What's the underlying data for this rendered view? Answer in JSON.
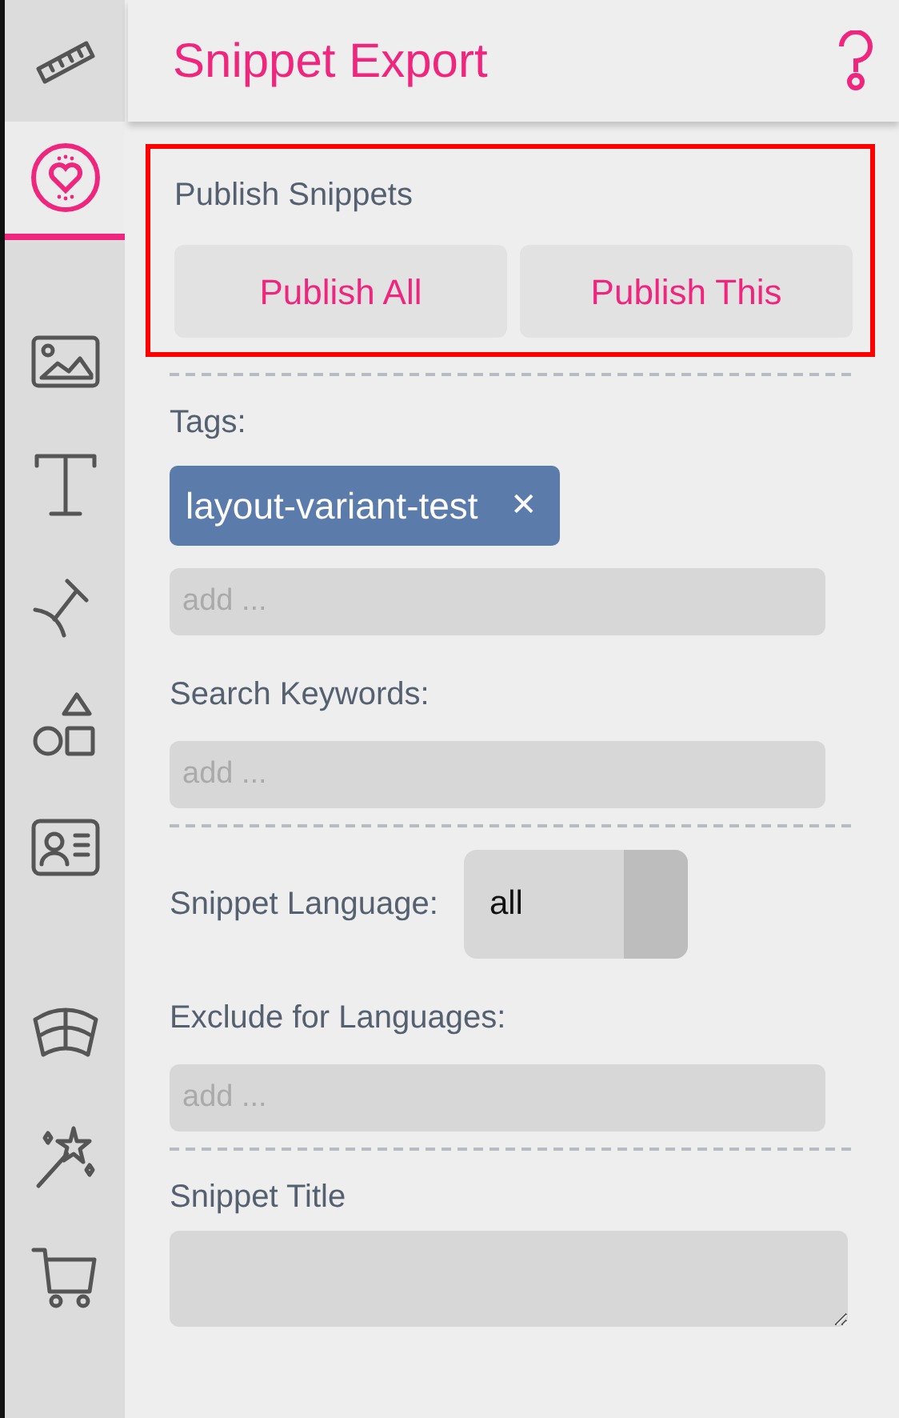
{
  "sidebar": {
    "groups": [
      {
        "items": [
          {
            "selected": false
          },
          {
            "selected": true
          }
        ]
      },
      {
        "items": [
          {
            "selected": false
          },
          {
            "selected": false
          },
          {
            "selected": false
          },
          {
            "selected": false
          },
          {
            "selected": false
          }
        ]
      },
      {
        "items": [
          {
            "selected": false
          },
          {
            "selected": false
          },
          {
            "selected": false
          }
        ]
      }
    ]
  },
  "header": {
    "title": "Snippet Export"
  },
  "publish": {
    "title": "Publish Snippets",
    "highlighted": true,
    "buttons": [
      "Publish All",
      "Publish This"
    ]
  },
  "fields": [
    {
      "kind": "divider"
    },
    {
      "kind": "label",
      "text": "Tags:"
    },
    {
      "kind": "tags",
      "tags": [
        {
          "label": "layout-variant-test",
          "remove": "✕"
        }
      ]
    },
    {
      "kind": "input",
      "placeholder": "add ..."
    },
    {
      "kind": "label",
      "text": "Search Keywords:"
    },
    {
      "kind": "input",
      "placeholder": "add ..."
    },
    {
      "kind": "divider"
    },
    {
      "kind": "select",
      "label": "Snippet Language:",
      "value": "all"
    },
    {
      "kind": "label",
      "text": "Exclude for Languages:"
    },
    {
      "kind": "input",
      "placeholder": "add ..."
    },
    {
      "kind": "divider"
    },
    {
      "kind": "label",
      "text": "Snippet Title"
    },
    {
      "kind": "textarea"
    }
  ]
}
